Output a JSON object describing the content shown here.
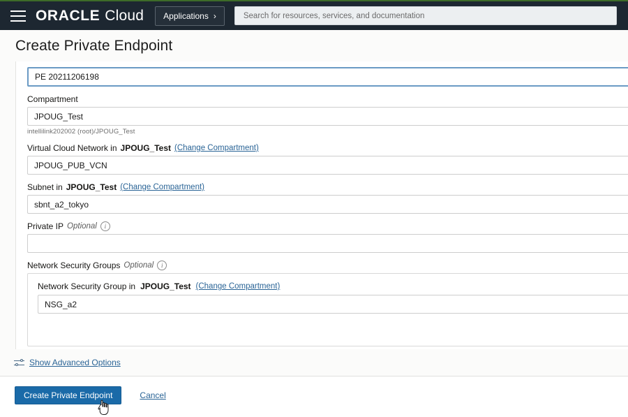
{
  "header": {
    "menu_icon": "hamburger-icon",
    "brand_primary": "ORACLE",
    "brand_secondary": "Cloud",
    "applications_label": "Applications",
    "applications_chevron": "›",
    "search_placeholder": "Search for resources, services, and documentation",
    "search_value": "",
    "accent_top_color": "#3d6b28",
    "bar_color": "#1d2731"
  },
  "page": {
    "title": "Create Private Endpoint"
  },
  "form": {
    "name_field": {
      "value": "PE 20211206198"
    },
    "compartment": {
      "label": "Compartment",
      "value": "JPOUG_Test",
      "hint": "intellilink202002 (root)/JPOUG_Test"
    },
    "vcn": {
      "label_prefix": "Virtual Cloud Network in",
      "label_compartment": "JPOUG_Test",
      "change_link": "(Change Compartment)",
      "value": "JPOUG_PUB_VCN"
    },
    "subnet": {
      "label_prefix": "Subnet in",
      "label_compartment": "JPOUG_Test",
      "change_link": "(Change Compartment)",
      "value": "sbnt_a2_tokyo"
    },
    "private_ip": {
      "label": "Private IP",
      "optional": "Optional",
      "info_icon": "info-icon",
      "value": ""
    },
    "network_security_groups": {
      "label": "Network Security Groups",
      "optional": "Optional",
      "info_icon": "info-icon",
      "inner_label_prefix": "Network Security Group in",
      "inner_label_compartment": "JPOUG_Test",
      "change_link": "(Change Compartment)",
      "value": "NSG_a2"
    }
  },
  "advanced": {
    "icon": "sliders-icon",
    "label": "Show Advanced Options"
  },
  "footer": {
    "primary_label": "Create Private Endpoint",
    "cancel_label": "Cancel",
    "primary_color": "#1a6aa8",
    "link_color": "#2a6496"
  }
}
